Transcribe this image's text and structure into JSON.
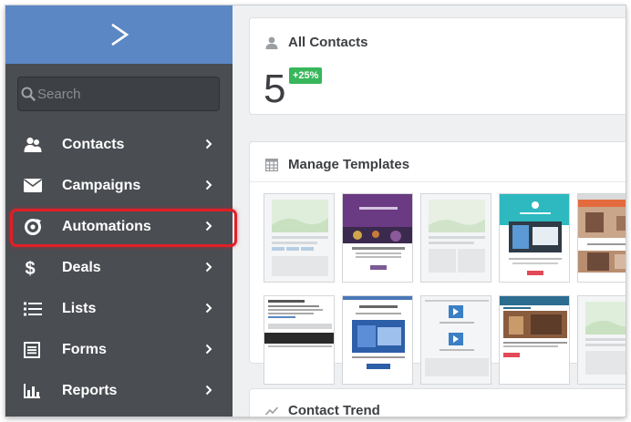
{
  "sidebar": {
    "search": {
      "placeholder": "Search"
    },
    "items": [
      {
        "label": "Contacts",
        "icon": "contacts-icon"
      },
      {
        "label": "Campaigns",
        "icon": "envelope-icon"
      },
      {
        "label": "Automations",
        "icon": "automations-icon",
        "highlighted": true
      },
      {
        "label": "Deals",
        "icon": "dollar-icon"
      },
      {
        "label": "Lists",
        "icon": "list-icon"
      },
      {
        "label": "Forms",
        "icon": "form-icon"
      },
      {
        "label": "Reports",
        "icon": "bar-chart-icon"
      }
    ]
  },
  "contacts_card": {
    "title": "All Contacts",
    "count": "5",
    "change_badge": "+25%"
  },
  "templates_card": {
    "title": "Manage Templates"
  },
  "trend_card": {
    "title": "Contact Trend"
  },
  "colors": {
    "sidebar_bg": "#4a4d52",
    "header_bg": "#5b87c5",
    "highlight": "#e11f26",
    "badge_green": "#37b65a"
  }
}
